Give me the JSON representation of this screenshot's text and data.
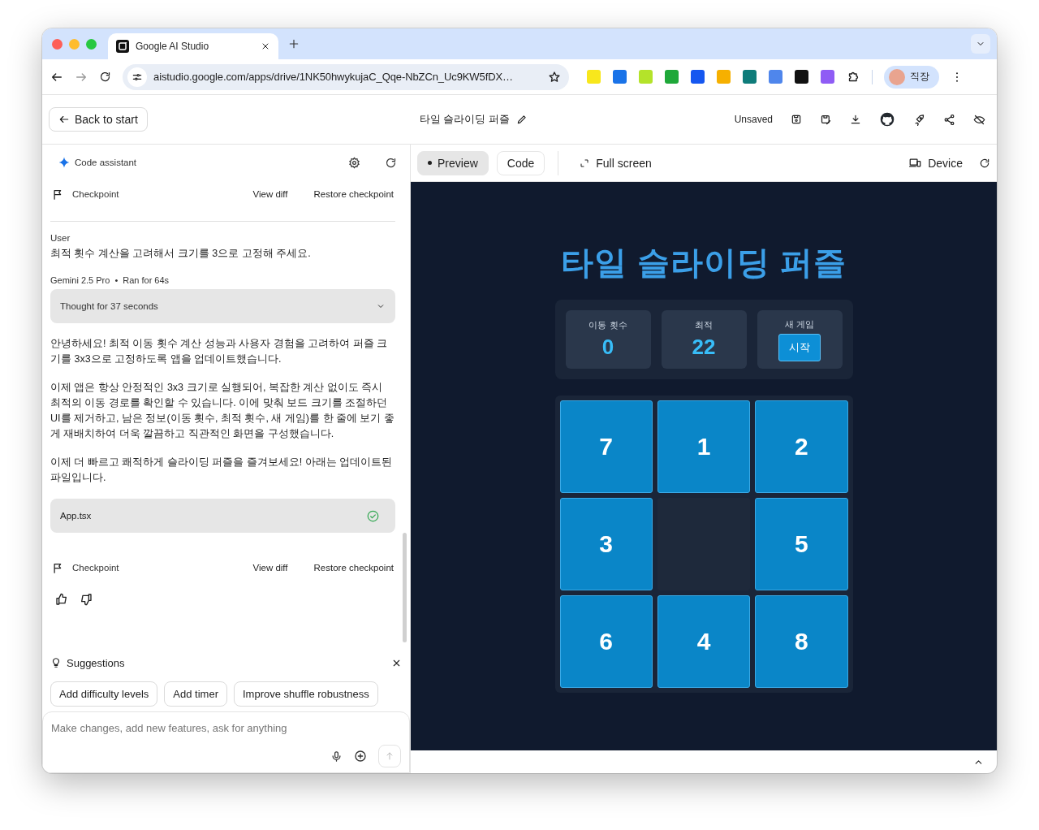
{
  "browser": {
    "tab_title": "Google AI Studio",
    "url": "aistudio.google.com/apps/drive/1NK50hwykujaC_Qqe-NbZCn_Uc9KW5fDX…",
    "profile_label": "직장"
  },
  "header": {
    "back_button": "Back to start",
    "project_title": "타일 슬라이딩 퍼즐",
    "save_status": "Unsaved"
  },
  "assistant": {
    "title": "Code assistant"
  },
  "chat": [
    {
      "kind": "checkpoint",
      "label": "Checkpoint",
      "view_diff": "View diff",
      "restore": "Restore checkpoint"
    },
    {
      "kind": "user",
      "author": "User",
      "text": "최적 횟수 계산을 고려해서 크기를 3으로 고정해 주세요."
    },
    {
      "kind": "model_meta",
      "model": "Gemini 2.5 Pro",
      "separator": "•",
      "duration": "Ran for 64s"
    },
    {
      "kind": "thought",
      "label": "Thought for 37 seconds",
      "expanded": false
    },
    {
      "kind": "paragraph",
      "text": "안녕하세요! 최적 이동 횟수 계산 성능과 사용자 경험을 고려하여 퍼즐 크기를 3x3으로 고정하도록 앱을 업데이트했습니다."
    },
    {
      "kind": "paragraph",
      "text": "이제 앱은 항상 안정적인 3x3 크기로 실행되어, 복잡한 계산 없이도 즉시 최적의 이동 경로를 확인할 수 있습니다. 이에 맞춰 보드 크기를 조절하던 UI를 제거하고, 남은 정보(이동 횟수, 최적 횟수, 새 게임)를 한 줄에 보기 좋게 재배치하여 더욱 깔끔하고 직관적인 화면을 구성했습니다."
    },
    {
      "kind": "paragraph",
      "text": "이제 더 빠르고 쾌적하게 슬라이딩 퍼즐을 즐겨보세요! 아래는 업데이트된 파일입니다."
    },
    {
      "kind": "file",
      "name": "App.tsx",
      "done": true
    },
    {
      "kind": "checkpoint",
      "label": "Checkpoint",
      "view_diff": "View diff",
      "restore": "Restore checkpoint"
    },
    {
      "kind": "feedback"
    }
  ],
  "suggestions": {
    "title": "Suggestions",
    "chips": [
      "Add difficulty levels",
      "Add timer",
      "Improve shuffle robustness"
    ]
  },
  "composer": {
    "placeholder": "Make changes, add new features, ask for anything"
  },
  "preview_toolbar": {
    "tabs": [
      {
        "label": "Preview",
        "selected": true
      },
      {
        "label": "Code",
        "selected": false
      }
    ],
    "full_screen": "Full screen",
    "device": "Device"
  },
  "game": {
    "title": "타일 슬라이딩 퍼즐",
    "stats": [
      {
        "label": "이동 횟수",
        "value": "0"
      },
      {
        "label": "최적",
        "value": "22"
      }
    ],
    "new_game": {
      "label": "새 게임",
      "button": "시작"
    },
    "tiles": [
      {
        "kind": "tile",
        "number": "7"
      },
      {
        "kind": "tile",
        "number": "1"
      },
      {
        "kind": "tile",
        "number": "2"
      },
      {
        "kind": "tile",
        "number": "3"
      },
      {
        "kind": "blank"
      },
      {
        "kind": "tile",
        "number": "5"
      },
      {
        "kind": "tile",
        "number": "6"
      },
      {
        "kind": "tile",
        "number": "4"
      },
      {
        "kind": "tile",
        "number": "8"
      }
    ]
  }
}
